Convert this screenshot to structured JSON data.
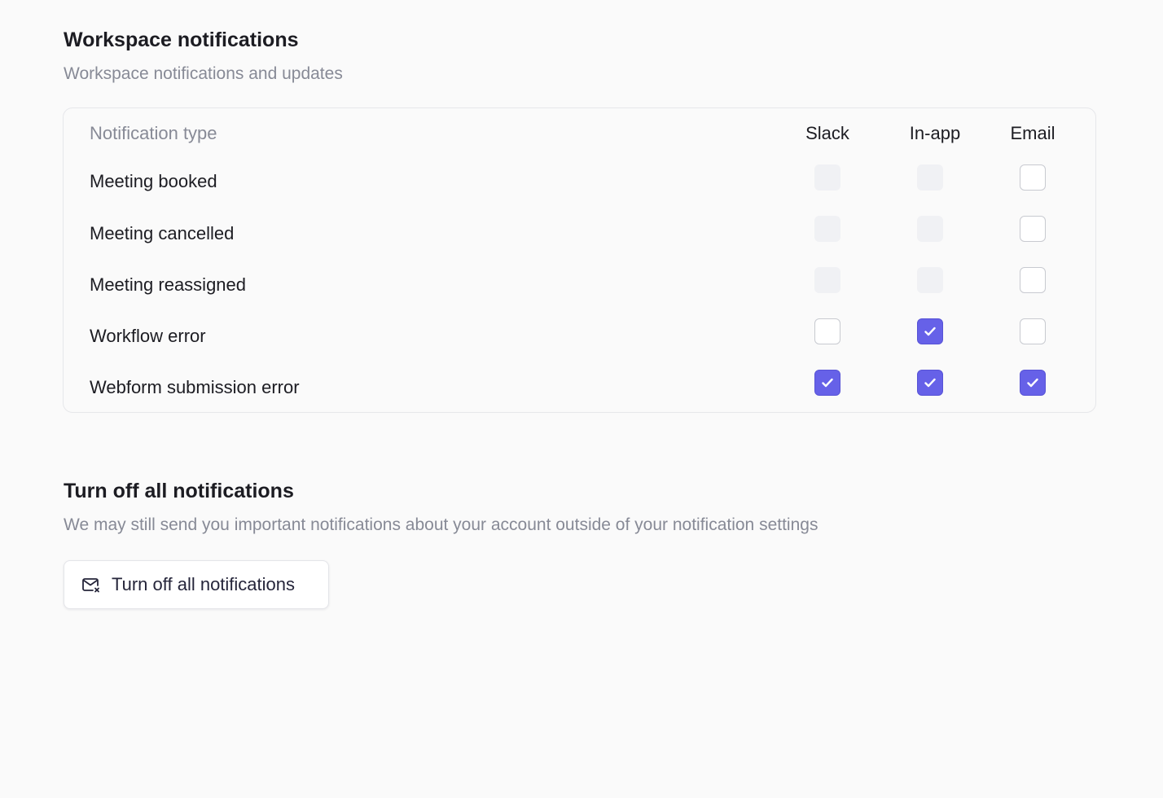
{
  "workspace": {
    "title": "Workspace notifications",
    "subtitle": "Workspace notifications and updates",
    "columns": {
      "type": "Notification type",
      "slack": "Slack",
      "inapp": "In-app",
      "email": "Email"
    },
    "rows": [
      {
        "label": "Meeting booked",
        "slack": "disabled",
        "inapp": "disabled",
        "email": "unchecked"
      },
      {
        "label": "Meeting cancelled",
        "slack": "disabled",
        "inapp": "disabled",
        "email": "unchecked"
      },
      {
        "label": "Meeting reassigned",
        "slack": "disabled",
        "inapp": "disabled",
        "email": "unchecked"
      },
      {
        "label": "Workflow error",
        "slack": "unchecked",
        "inapp": "checked",
        "email": "unchecked"
      },
      {
        "label": "Webform submission error",
        "slack": "checked",
        "inapp": "checked",
        "email": "checked"
      }
    ]
  },
  "turn_off": {
    "title": "Turn off all notifications",
    "subtitle": "We may still send you important notifications about your account outside of your notification settings",
    "button_label": "Turn off all notifications",
    "button_icon": "mail-off-icon"
  },
  "colors": {
    "accent": "#6661e8",
    "muted_text": "#878a96",
    "disabled_checkbox": "#f0f1f4"
  }
}
